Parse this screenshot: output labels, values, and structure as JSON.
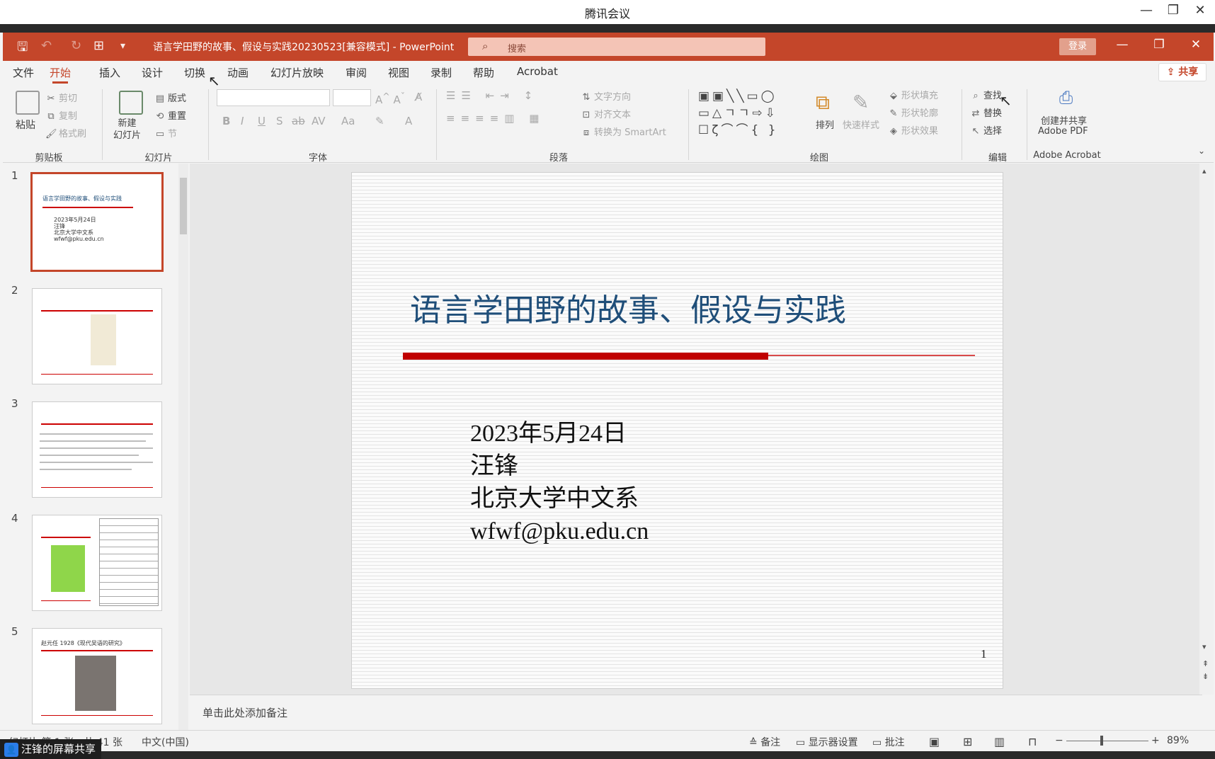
{
  "meeting": {
    "title": "腾讯会议",
    "share_badge": "汪锋的屏幕共享"
  },
  "ppt": {
    "doc_title": "语言学田野的故事、假设与实践20230523[兼容模式] - PowerPoint",
    "search_placeholder": "搜索",
    "login": "登录",
    "share": "共享",
    "tabs": [
      "文件",
      "开始",
      "插入",
      "设计",
      "切换",
      "动画",
      "幻灯片放映",
      "审阅",
      "视图",
      "录制",
      "帮助",
      "Acrobat"
    ],
    "active_tab": "开始"
  },
  "ribbon": {
    "clipboard": {
      "paste": "粘贴",
      "cut": "剪切",
      "copy": "复制",
      "format_painter": "格式刷",
      "label": "剪贴板"
    },
    "slides": {
      "new_slide": "新建\n幻灯片",
      "layout": "版式",
      "reset": "重置",
      "section": "节",
      "label": "幻灯片"
    },
    "font": {
      "label": "字体",
      "buttons": [
        "B",
        "I",
        "U",
        "S",
        "ab",
        "AV",
        "Aa"
      ]
    },
    "paragraph": {
      "text_direction": "文字方向",
      "align_text": "对齐文本",
      "smartart": "转换为 SmartArt",
      "label": "段落"
    },
    "drawing": {
      "arrange": "排列",
      "quick_styles": "快速样式",
      "shape_fill": "形状填充",
      "shape_outline": "形状轮廓",
      "shape_effects": "形状效果",
      "label": "绘图"
    },
    "editing": {
      "find": "查找",
      "replace": "替换",
      "select": "选择",
      "label": "编辑"
    },
    "acrobat": {
      "create_share": "创建并共享",
      "pdf": "Adobe PDF",
      "label": "Adobe Acrobat"
    }
  },
  "thumbnails": [
    {
      "num": "1",
      "title": "语言学田野的故事、假设与实践",
      "lines": [
        "2023年5月24日",
        "汪锋",
        "北京大学中文系",
        "wfwf@pku.edu.cn"
      ]
    },
    {
      "num": "2"
    },
    {
      "num": "3"
    },
    {
      "num": "4"
    },
    {
      "num": "5",
      "title": "赵元任 1928《现代吴语的研究》"
    }
  ],
  "slide": {
    "title": "语言学田野的故事、假设与实践",
    "lines": [
      "2023年5月24日",
      "汪锋",
      "北京大学中文系",
      "wfwf@pku.edu.cn"
    ],
    "page_number": "1"
  },
  "notes_placeholder": "单击此处添加备注",
  "status": {
    "slide_info": "幻灯片 第 1 张，共 41 张",
    "language": "中文(中国)",
    "notes": "备注",
    "display_settings": "显示器设置",
    "comments": "批注",
    "zoom": "89%"
  },
  "colors": {
    "accent": "#c4462a",
    "slide_title": "#1f4e79",
    "slide_bar": "#c00000"
  }
}
